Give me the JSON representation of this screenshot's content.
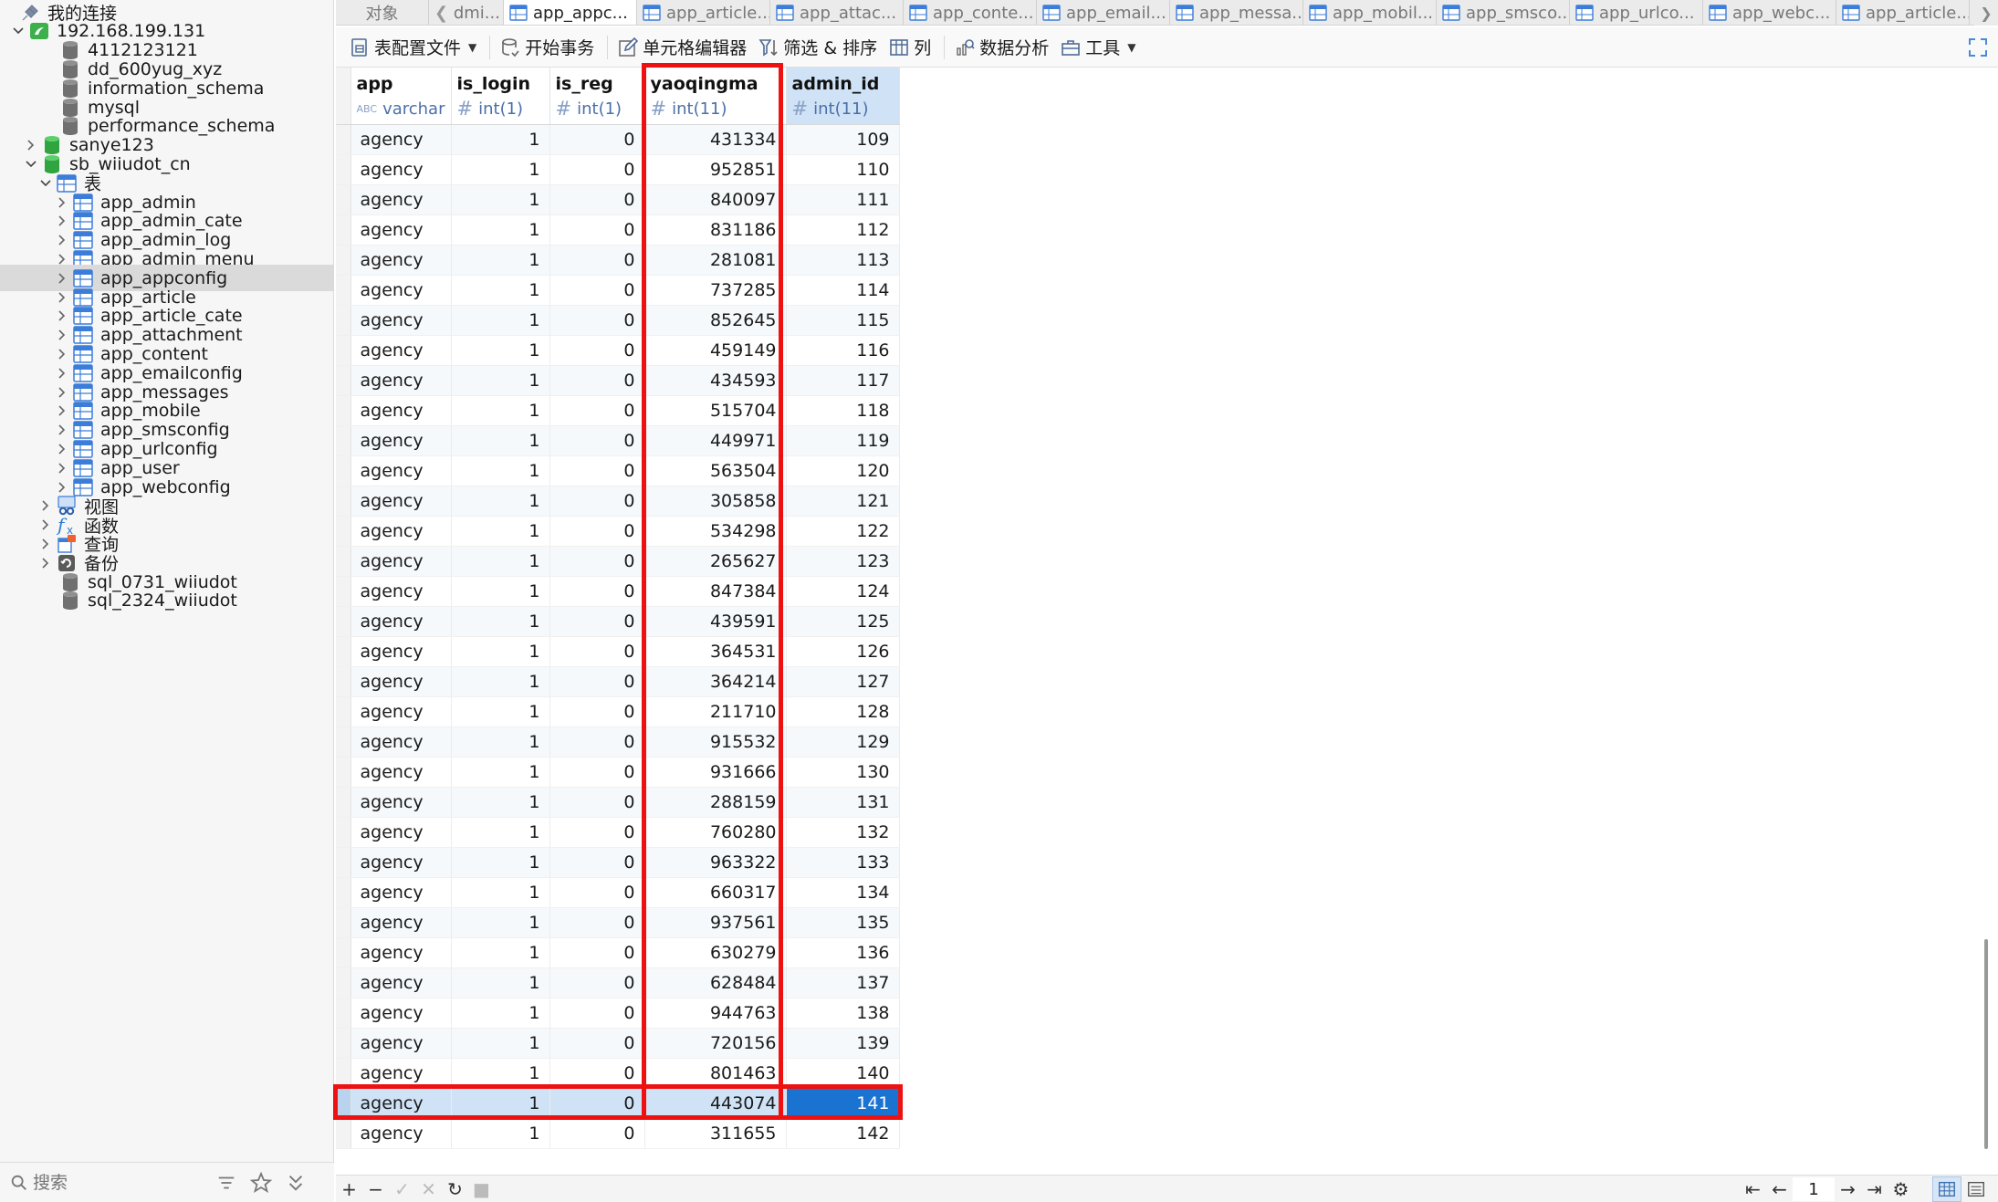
{
  "sidebar": {
    "root_label": "我的连接",
    "connection": "192.168.199.131",
    "databases_before": [
      "4112123121",
      "dd_600yug_xyz",
      "information_schema",
      "mysql",
      "performance_schema",
      "sanye123"
    ],
    "open_database": "sb_wiiudot_cn",
    "tables_group": "表",
    "tables": [
      "app_admin",
      "app_admin_cate",
      "app_admin_log",
      "app_admin_menu",
      "app_appconfig",
      "app_article",
      "app_article_cate",
      "app_attachment",
      "app_content",
      "app_emailconfig",
      "app_messages",
      "app_mobile",
      "app_smsconfig",
      "app_urlconfig",
      "app_user",
      "app_webconfig"
    ],
    "selected_table": "app_appconfig",
    "groups": [
      "视图",
      "函数",
      "查询",
      "备份"
    ],
    "databases_after": [
      "sql_0731_wiiudot",
      "sql_2324_wiiudot"
    ],
    "search_placeholder": "搜索"
  },
  "tabs": {
    "objects": "对象",
    "items": [
      "dmi...",
      "app_appc...",
      "app_article...",
      "app_attac...",
      "app_conte...",
      "app_email...",
      "app_messa...",
      "app_mobil...",
      "app_smsco...",
      "app_urlco...",
      "app_webc...",
      "app_article..."
    ],
    "active_index": 1
  },
  "toolbar": {
    "table_config": "表配置文件",
    "begin_transaction": "开始事务",
    "cell_editor": "单元格编辑器",
    "filter_sort": "筛选 & 排序",
    "columns": "列",
    "data_analysis": "数据分析",
    "tools": "工具"
  },
  "grid": {
    "columns": [
      {
        "name": "app",
        "type": "varchar",
        "glyph": "ABC"
      },
      {
        "name": "is_login",
        "type": "int(1)",
        "glyph": "#"
      },
      {
        "name": "is_reg",
        "type": "int(1)",
        "glyph": "#"
      },
      {
        "name": "yaoqingma",
        "type": "int(11)",
        "glyph": "#"
      },
      {
        "name": "admin_id",
        "type": "int(11)",
        "glyph": "#"
      }
    ],
    "rows": [
      [
        "agency",
        "1",
        "0",
        "431334",
        "109"
      ],
      [
        "agency",
        "1",
        "0",
        "952851",
        "110"
      ],
      [
        "agency",
        "1",
        "0",
        "840097",
        "111"
      ],
      [
        "agency",
        "1",
        "0",
        "831186",
        "112"
      ],
      [
        "agency",
        "1",
        "0",
        "281081",
        "113"
      ],
      [
        "agency",
        "1",
        "0",
        "737285",
        "114"
      ],
      [
        "agency",
        "1",
        "0",
        "852645",
        "115"
      ],
      [
        "agency",
        "1",
        "0",
        "459149",
        "116"
      ],
      [
        "agency",
        "1",
        "0",
        "434593",
        "117"
      ],
      [
        "agency",
        "1",
        "0",
        "515704",
        "118"
      ],
      [
        "agency",
        "1",
        "0",
        "449971",
        "119"
      ],
      [
        "agency",
        "1",
        "0",
        "563504",
        "120"
      ],
      [
        "agency",
        "1",
        "0",
        "305858",
        "121"
      ],
      [
        "agency",
        "1",
        "0",
        "534298",
        "122"
      ],
      [
        "agency",
        "1",
        "0",
        "265627",
        "123"
      ],
      [
        "agency",
        "1",
        "0",
        "847384",
        "124"
      ],
      [
        "agency",
        "1",
        "0",
        "439591",
        "125"
      ],
      [
        "agency",
        "1",
        "0",
        "364531",
        "126"
      ],
      [
        "agency",
        "1",
        "0",
        "364214",
        "127"
      ],
      [
        "agency",
        "1",
        "0",
        "211710",
        "128"
      ],
      [
        "agency",
        "1",
        "0",
        "915532",
        "129"
      ],
      [
        "agency",
        "1",
        "0",
        "931666",
        "130"
      ],
      [
        "agency",
        "1",
        "0",
        "288159",
        "131"
      ],
      [
        "agency",
        "1",
        "0",
        "760280",
        "132"
      ],
      [
        "agency",
        "1",
        "0",
        "963322",
        "133"
      ],
      [
        "agency",
        "1",
        "0",
        "660317",
        "134"
      ],
      [
        "agency",
        "1",
        "0",
        "937561",
        "135"
      ],
      [
        "agency",
        "1",
        "0",
        "630279",
        "136"
      ],
      [
        "agency",
        "1",
        "0",
        "628484",
        "137"
      ],
      [
        "agency",
        "1",
        "0",
        "944763",
        "138"
      ],
      [
        "agency",
        "1",
        "0",
        "720156",
        "139"
      ],
      [
        "agency",
        "1",
        "0",
        "801463",
        "140"
      ],
      [
        "agency",
        "1",
        "0",
        "443074",
        "141"
      ],
      [
        "agency",
        "1",
        "0",
        "311655",
        "142"
      ]
    ],
    "selected_row_index": 32,
    "highlight_color": "#ee1111",
    "selection_color": "#1a73d1"
  },
  "pager": {
    "page": "1"
  }
}
